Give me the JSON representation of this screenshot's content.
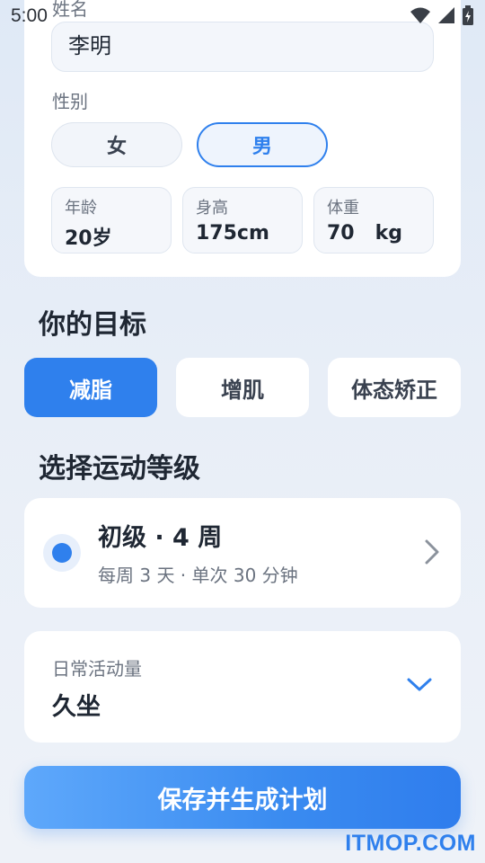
{
  "status_bar": {
    "time": "5:00",
    "icons": [
      "wifi-icon",
      "signal-icon",
      "battery-icon"
    ]
  },
  "profile": {
    "name_label": "姓名",
    "name_value": "李明",
    "gender_label": "性别",
    "gender_options": [
      "女",
      "男"
    ],
    "gender_selected": "男",
    "metrics": [
      {
        "label": "年龄",
        "value": "20岁"
      },
      {
        "label": "身高",
        "value": "175cm"
      },
      {
        "label": "体重",
        "value": "70   kg"
      }
    ]
  },
  "goal": {
    "title": "你的目标",
    "options": [
      "减脂",
      "增肌",
      "体态矫正"
    ],
    "selected": "减脂"
  },
  "level": {
    "title": "选择运动等级",
    "selected_title": "初级 · 4 周",
    "selected_subtitle": "每周 3 天 · 单次 30 分钟"
  },
  "activity": {
    "label": "日常活动量",
    "value": "久坐"
  },
  "actions": {
    "save_label": "保存并生成计划"
  },
  "watermark": "ITMOP.COM",
  "colors": {
    "accent": "#2f80ed",
    "card": "#ffffff",
    "background": "#e8eef7"
  }
}
